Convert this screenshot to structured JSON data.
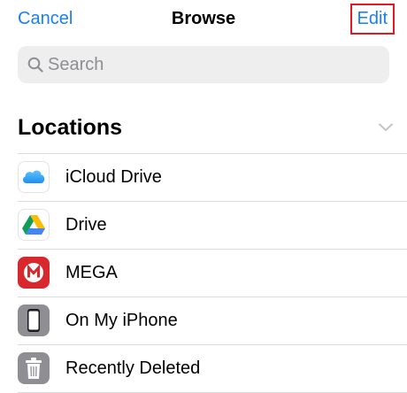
{
  "nav": {
    "cancel_label": "Cancel",
    "title": "Browse",
    "edit_label": "Edit"
  },
  "search": {
    "placeholder": "Search",
    "value": ""
  },
  "locations": {
    "title": "Locations",
    "items": [
      {
        "label": "iCloud Drive",
        "icon": "icloud-drive-icon"
      },
      {
        "label": "Drive",
        "icon": "google-drive-icon"
      },
      {
        "label": "MEGA",
        "icon": "mega-icon"
      },
      {
        "label": "On My iPhone",
        "icon": "iphone-icon"
      },
      {
        "label": "Recently Deleted",
        "icon": "trash-icon"
      }
    ]
  },
  "colors": {
    "accent": "#1a7ef5",
    "highlight": "#e01b24",
    "search_bg": "#eeeeef",
    "separator": "#dcdcdf",
    "mega_red": "#d9272e",
    "system_gray": "#8e8e93"
  }
}
